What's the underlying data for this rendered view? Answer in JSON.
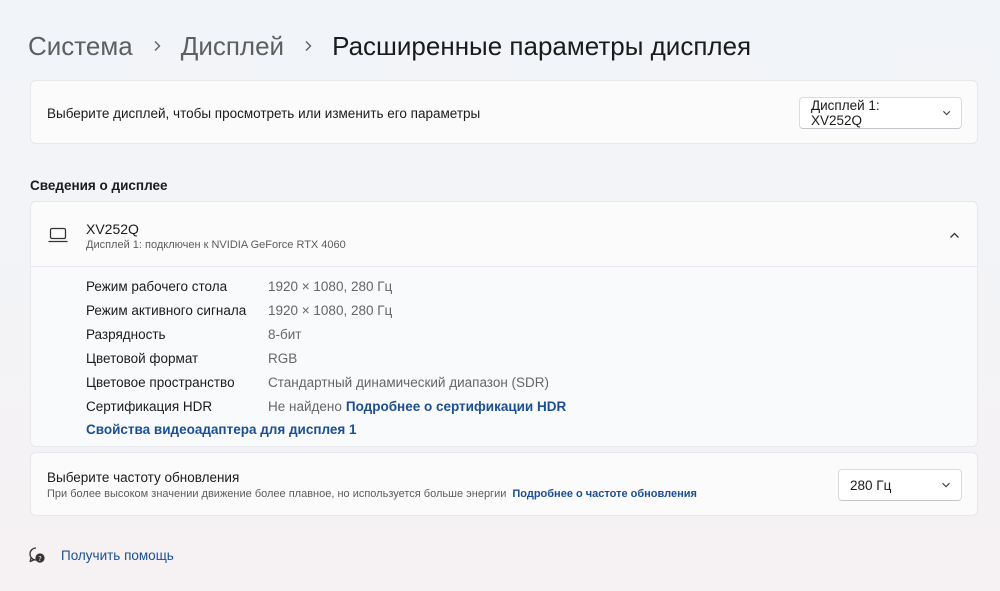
{
  "breadcrumb": {
    "items": [
      "Система",
      "Дисплей"
    ],
    "current": "Расширенные параметры дисплея"
  },
  "display_select": {
    "label": "Выберите дисплей, чтобы просмотреть или изменить его параметры",
    "selected": "Дисплей 1: XV252Q"
  },
  "info_section": {
    "title": "Сведения о дисплее",
    "monitor_name": "XV252Q",
    "monitor_sub": "Дисплей 1: подключен к NVIDIA GeForce RTX 4060",
    "icon": "monitor-icon",
    "rows": [
      {
        "key": "Режим рабочего стола",
        "value": "1920 × 1080, 280 Гц"
      },
      {
        "key": "Режим активного сигнала",
        "value": "1920 × 1080, 280 Гц"
      },
      {
        "key": "Разрядность",
        "value": "8-бит"
      },
      {
        "key": "Цветовой формат",
        "value": "RGB"
      },
      {
        "key": "Цветовое пространство",
        "value": "Стандартный динамический диапазон (SDR)"
      },
      {
        "key": "Сертификация HDR",
        "value": "Не найдено",
        "link": "Подробнее о сертификации HDR"
      }
    ],
    "adapter_link": "Свойства видеоадаптера для дисплея 1"
  },
  "refresh": {
    "title": "Выберите частоту обновления",
    "description": "При более высоком значении движение более плавное, но используется больше энергии",
    "link": "Подробнее о частоте обновления",
    "selected": "280 Гц"
  },
  "help": {
    "label": "Получить помощь",
    "icon": "help-icon"
  },
  "colors": {
    "accent_link": "#1a4f96",
    "card_bg": "#fbfbfc",
    "text_secondary": "#5c5c5c"
  }
}
